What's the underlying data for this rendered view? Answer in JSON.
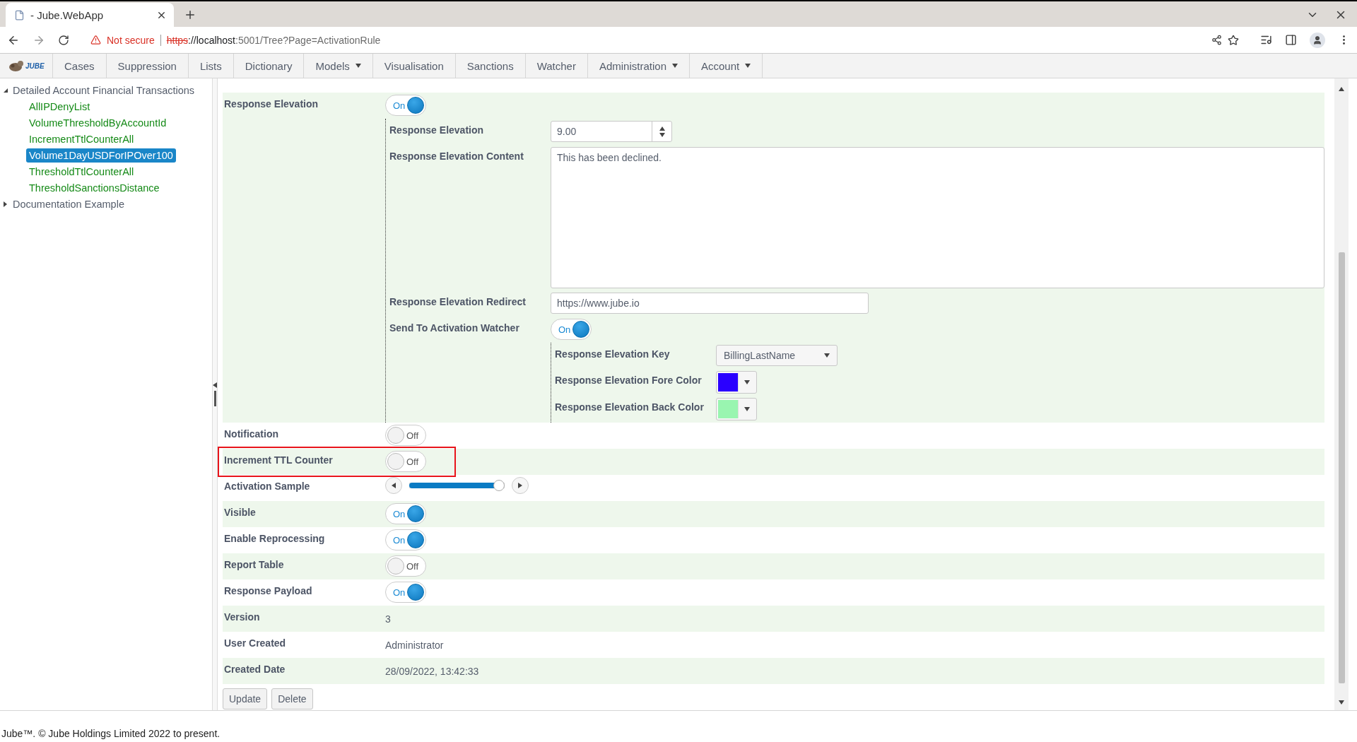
{
  "browser": {
    "tab_title": "- Jube.WebApp",
    "security": "Not secure",
    "url_scheme": "https",
    "url_host": "://localhost",
    "url_path": ":5001/Tree?Page=ActivationRule"
  },
  "nav": {
    "logo": "JUBE",
    "items": [
      {
        "label": "Cases",
        "dropdown": false
      },
      {
        "label": "Suppression",
        "dropdown": false
      },
      {
        "label": "Lists",
        "dropdown": false
      },
      {
        "label": "Dictionary",
        "dropdown": false
      },
      {
        "label": "Models",
        "dropdown": true
      },
      {
        "label": "Visualisation",
        "dropdown": false
      },
      {
        "label": "Sanctions",
        "dropdown": false
      },
      {
        "label": "Watcher",
        "dropdown": false
      },
      {
        "label": "Administration",
        "dropdown": true
      },
      {
        "label": "Account",
        "dropdown": true
      }
    ]
  },
  "tree": [
    {
      "label": "Detailed Account Financial Transactions",
      "expanded": true,
      "children": [
        {
          "label": "AllIPDenyList",
          "selected": false
        },
        {
          "label": "VolumeThresholdByAccountId",
          "selected": false
        },
        {
          "label": "IncrementTtlCounterAll",
          "selected": false
        },
        {
          "label": "Volume1DayUSDForIPOver100",
          "selected": true
        },
        {
          "label": "ThresholdTtlCounterAll",
          "selected": false
        },
        {
          "label": "ThresholdSanctionsDistance",
          "selected": false
        }
      ]
    },
    {
      "label": "Documentation Example",
      "expanded": false
    }
  ],
  "form": {
    "rows": [
      {
        "kind": "toggle",
        "label": "Response Elevation",
        "on": true,
        "toggle_label": "On",
        "children": [
          {
            "kind": "number",
            "label": "Response Elevation",
            "value": "9.00"
          },
          {
            "kind": "textarea",
            "label": "Response Elevation Content",
            "value": "This has been declined."
          },
          {
            "kind": "text",
            "label": "Response Elevation Redirect",
            "value": "https://www.jube.io"
          },
          {
            "kind": "toggle",
            "label": "Send To Activation Watcher",
            "on": true,
            "toggle_label": "On",
            "children": [
              {
                "kind": "select",
                "label": "Response Elevation Key",
                "value": "BillingLastName"
              },
              {
                "kind": "color",
                "label": "Response Elevation Fore Color",
                "color": "#2a00ff"
              },
              {
                "kind": "color",
                "label": "Response Elevation Back Color",
                "color": "#99f5b0"
              }
            ]
          }
        ]
      },
      {
        "kind": "toggle",
        "label": "Notification",
        "on": false,
        "toggle_label": "Off"
      },
      {
        "kind": "toggle",
        "label": "Increment TTL Counter",
        "on": false,
        "toggle_label": "Off",
        "highlighted": true
      },
      {
        "kind": "slider",
        "label": "Activation Sample",
        "level": 0.96
      },
      {
        "kind": "toggle",
        "label": "Visible",
        "on": true,
        "toggle_label": "On"
      },
      {
        "kind": "toggle",
        "label": "Enable Reprocessing",
        "on": true,
        "toggle_label": "On"
      },
      {
        "kind": "toggle",
        "label": "Report Table",
        "on": false,
        "toggle_label": "Off"
      },
      {
        "kind": "toggle",
        "label": "Response Payload",
        "on": true,
        "toggle_label": "On"
      },
      {
        "kind": "value",
        "label": "Version",
        "value": "3"
      },
      {
        "kind": "value",
        "label": "User Created",
        "value": "Administrator"
      },
      {
        "kind": "value",
        "label": "Created Date",
        "value": "28/09/2022, 13:42:33"
      }
    ],
    "buttons": [
      "Update",
      "Delete"
    ]
  },
  "footer": "Jube™. © Jube Holdings Limited 2022 to present."
}
